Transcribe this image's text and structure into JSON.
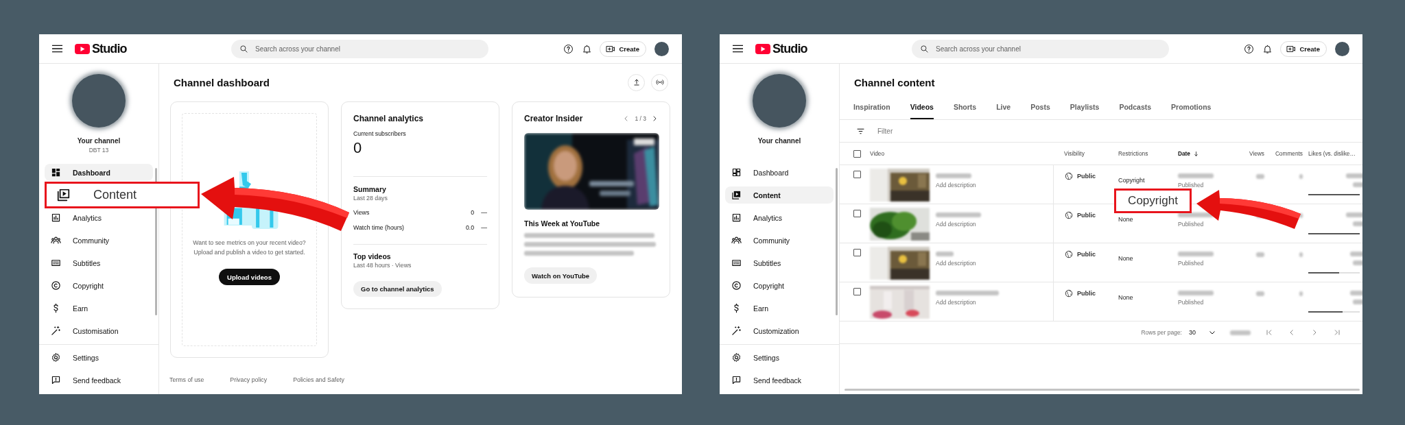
{
  "panels": [
    {
      "kind": "dashboard",
      "topbar": {
        "logo_text": "Studio",
        "search": {
          "placeholder": "Search across your channel"
        },
        "create_label": "Create"
      },
      "sidebar": {
        "channel_name": "Your channel",
        "channel_handle": "DBT 13",
        "nav": [
          {
            "label": "Dashboard",
            "kind": "item",
            "selected": true
          },
          {
            "label": "Content",
            "kind": "callout",
            "selected": false
          },
          {
            "label": "Analytics",
            "kind": "item",
            "selected": false
          },
          {
            "label": "Community",
            "kind": "item",
            "selected": false
          },
          {
            "label": "Subtitles",
            "kind": "item",
            "selected": false
          },
          {
            "label": "Copyright",
            "kind": "item",
            "selected": false
          },
          {
            "label": "Earn",
            "kind": "item",
            "selected": false
          },
          {
            "label": "Customisation",
            "kind": "item",
            "selected": false
          }
        ],
        "bottom_nav": [
          {
            "label": "Settings",
            "selected": false
          },
          {
            "label": "Send feedback",
            "selected": false
          }
        ]
      },
      "main": {
        "title": "Channel dashboard",
        "upload_card": {
          "message": [
            "Want to see metrics on your recent video?",
            "Upload and publish a video to get started."
          ],
          "button": "Upload videos"
        },
        "analytics_card": {
          "title": "Channel analytics",
          "subscribers_label": "Current subscribers",
          "subscribers": "0",
          "summary_title": "Summary",
          "summary_period": "Last 28 days",
          "metrics": [
            {
              "label": "Views",
              "value": "0",
              "trend": "—"
            },
            {
              "label": "Watch time (hours)",
              "value": "0.0",
              "trend": "—"
            }
          ],
          "top_title": "Top videos",
          "top_period": "Last 48 hours · Views",
          "button": "Go to channel analytics"
        },
        "insider_card": {
          "title": "Creator Insider",
          "pager": "1 / 3",
          "video_title": "This Week at YouTube",
          "button": "Watch on YouTube"
        },
        "footer_links": [
          "Terms of use",
          "Privacy policy",
          "Policies and Safety"
        ]
      }
    },
    {
      "kind": "content",
      "topbar": {
        "logo_text": "Studio",
        "search": {
          "placeholder": "Search across your channel"
        },
        "create_label": "Create"
      },
      "sidebar": {
        "channel_name": "Your channel",
        "nav": [
          {
            "label": "Dashboard",
            "kind": "item",
            "selected": false
          },
          {
            "label": "Content",
            "kind": "item",
            "selected": true
          },
          {
            "label": "Analytics",
            "kind": "item",
            "selected": false
          },
          {
            "label": "Community",
            "kind": "item",
            "selected": false
          },
          {
            "label": "Subtitles",
            "kind": "item",
            "selected": false
          },
          {
            "label": "Copyright",
            "kind": "item",
            "selected": false
          },
          {
            "label": "Earn",
            "kind": "item",
            "selected": false
          },
          {
            "label": "Customization",
            "kind": "item",
            "selected": false
          }
        ],
        "bottom_nav": [
          {
            "label": "Settings",
            "selected": false
          },
          {
            "label": "Send feedback",
            "selected": false
          }
        ]
      },
      "main": {
        "title": "Channel content",
        "tabs": [
          {
            "label": "Inspiration",
            "selected": false
          },
          {
            "label": "Videos",
            "selected": true
          },
          {
            "label": "Shorts",
            "selected": false
          },
          {
            "label": "Live",
            "selected": false
          },
          {
            "label": "Posts",
            "selected": false
          },
          {
            "label": "Playlists",
            "selected": false
          },
          {
            "label": "Podcasts",
            "selected": false
          },
          {
            "label": "Promotions",
            "selected": false
          }
        ],
        "filter": {
          "placeholder": "Filter"
        },
        "table": {
          "header_checked": false,
          "columns": [
            {
              "label": "Video",
              "sorted": false
            },
            {
              "label": "Visibility",
              "sorted": false
            },
            {
              "label": "Restrictions",
              "sorted": false
            },
            {
              "label": "Date",
              "sorted": true
            },
            {
              "label": "Views",
              "sorted": false
            },
            {
              "label": "Comments",
              "sorted": false
            },
            {
              "label": "Likes (vs. dislike…",
              "sorted": false
            }
          ],
          "rows": [
            {
              "checked": false,
              "description": "Add description",
              "visibility": "Public",
              "restrictions": "Copyright",
              "status": "Published",
              "level": 1
            },
            {
              "checked": false,
              "description": "Add description",
              "visibility": "Public",
              "restrictions": "None",
              "status": "Published",
              "level": 1
            },
            {
              "checked": false,
              "description": "Add description",
              "visibility": "Public",
              "restrictions": "None",
              "status": "Published",
              "level": 0.6
            },
            {
              "checked": false,
              "description": "Add description",
              "visibility": "Public",
              "restrictions": "None",
              "status": "Published",
              "level": 0.66
            }
          ]
        },
        "pagination": {
          "label": "Rows per page:",
          "value": "30"
        },
        "callout": {
          "label": "Copyright"
        }
      }
    }
  ]
}
